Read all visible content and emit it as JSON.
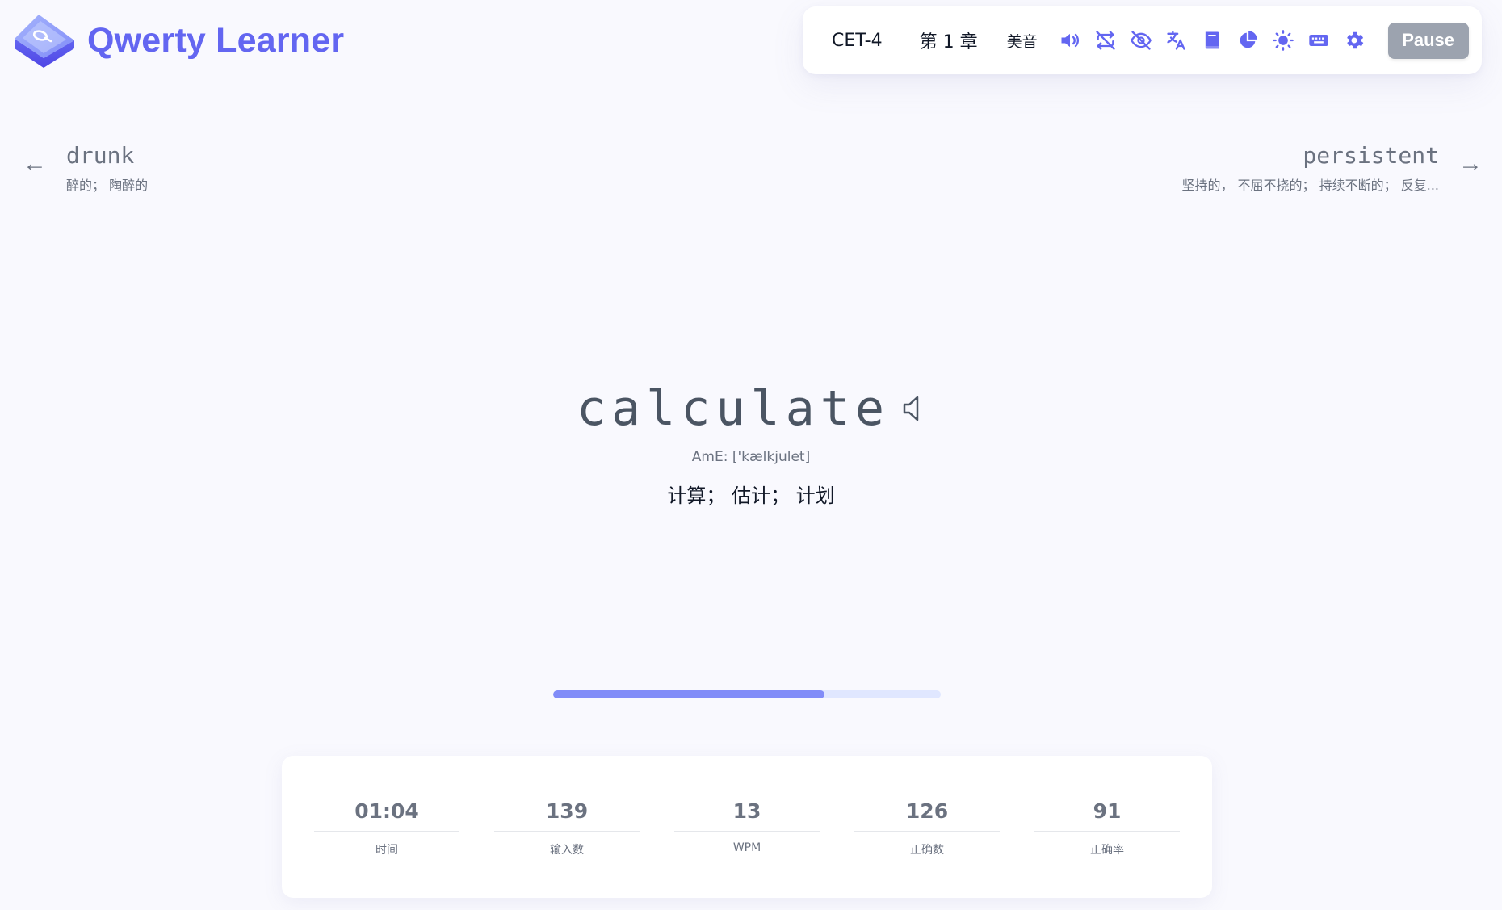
{
  "brand": {
    "title": "Qwerty Learner",
    "logo_icon": "keycap-q-logo-icon"
  },
  "toolbar": {
    "dictionary": "CET-4",
    "chapter": "第 1 章",
    "accent": "美音",
    "icons": [
      "speaker-icon",
      "loop-off-icon",
      "eye-off-icon",
      "translate-icon",
      "book-icon",
      "pie-chart-icon",
      "sun-icon",
      "keyboard-icon",
      "gear-icon"
    ],
    "pause_label": "Pause",
    "icon_color": "#6366f1"
  },
  "prev": {
    "word": "drunk",
    "translation": "醉的； 陶醉的"
  },
  "next": {
    "word": "persistent",
    "translation": "坚持的， 不屈不挠的； 持续不断的； 反复..."
  },
  "current": {
    "word": "calculate",
    "phonetic": "AmE: ['kælkjulet]",
    "translation": "计算； 估计； 计划"
  },
  "progress": {
    "fraction": 0.7
  },
  "stats": [
    {
      "value": "01:04",
      "label": "时间"
    },
    {
      "value": "139",
      "label": "输入数"
    },
    {
      "value": "13",
      "label": "WPM"
    },
    {
      "value": "126",
      "label": "正确数"
    },
    {
      "value": "91",
      "label": "正确率"
    }
  ],
  "colors": {
    "accent": "#6366f1",
    "background": "#f9f9fe",
    "progress_fill": "#818cf8",
    "progress_track": "#e0e7ff",
    "pause_button": "#9ca3af"
  }
}
